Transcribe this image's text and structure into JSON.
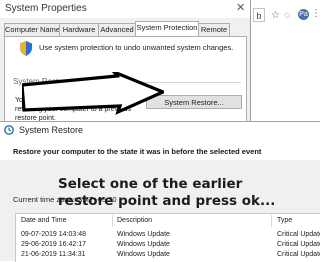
{
  "system_properties": {
    "title": "System Properties",
    "close_glyph": "✕",
    "tabs": [
      "Computer Name",
      "Hardware",
      "Advanced",
      "System Protection",
      "Remote"
    ],
    "active_tab": "System Protection",
    "intro_text": "Use system protection to undo unwanted system changes.",
    "system_restore_heading": "System Restore",
    "undo_text": "You can undo system changes by reverting your computer to a previous restore point.",
    "restore_button_label": "System Restore..."
  },
  "browser": {
    "tab_letter": "b",
    "avatar_letter": "Pa",
    "menu_glyph": "⋮"
  },
  "system_restore": {
    "title": "System Restore",
    "heading": "Restore your computer to the state it was in before the selected event",
    "overlay_note": "Select one of the earlier restore point and press ok...",
    "timezone": "Current time zone: GMT+05:30",
    "table": {
      "columns": [
        "Date and Time",
        "Description",
        "Type"
      ],
      "rows": [
        {
          "date": "09-07-2019 14:03:48",
          "description": "Windows Update",
          "type": "Critical Update"
        },
        {
          "date": "29-06-2019 16:42:17",
          "description": "Windows Update",
          "type": "Critical Update"
        },
        {
          "date": "21-06-2019 11:34:31",
          "description": "Windows Update",
          "type": "Critical Update"
        }
      ]
    }
  },
  "colors": {
    "window_bg": "#f0f0f0",
    "shield_blue": "#2f6fc4",
    "arrow": "#000000"
  }
}
